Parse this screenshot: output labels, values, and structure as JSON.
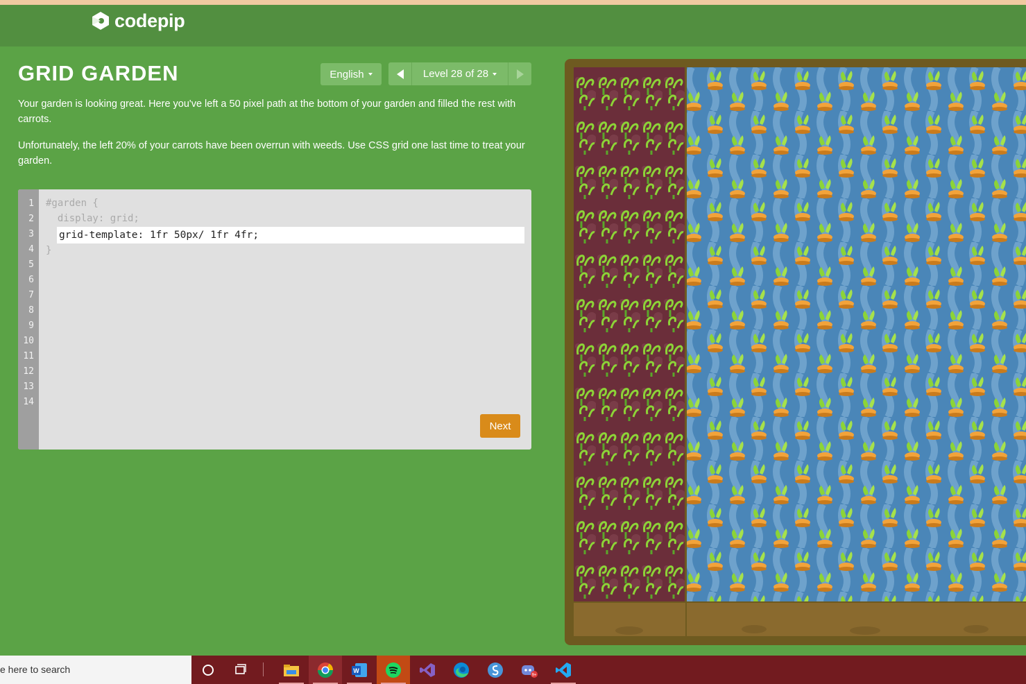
{
  "brand": {
    "name": "codepip"
  },
  "game": {
    "title": "GRID GARDEN",
    "language": "English",
    "level_label": "Level 28 of 28",
    "description": [
      "Your garden is looking great. Here you've left a 50 pixel path at the bottom of your garden and filled the rest with carrots.",
      "Unfortunately, the left 20% of your carrots have been overrun with weeds. Use CSS grid one last time to treat your garden."
    ]
  },
  "editor": {
    "line_numbers": [
      "1",
      "2",
      "3",
      "4",
      "5",
      "6",
      "7",
      "8",
      "9",
      "10",
      "11",
      "12",
      "13",
      "14"
    ],
    "code_line1": "#garden {",
    "code_line2": "  display: grid;",
    "input_value": "grid-template: 1fr 50px/ 1fr 4fr;",
    "code_line4": "}",
    "next_label": "Next"
  },
  "taskbar": {
    "search_text": "e here to search",
    "icons": [
      "cortana-icon",
      "task-view-icon",
      "file-explorer-icon",
      "chrome-icon",
      "word-icon",
      "spotify-icon",
      "visual-studio-icon",
      "edge-icon",
      "simplenote-icon",
      "discord-icon",
      "vscode-icon"
    ]
  },
  "colors": {
    "page_bg": "#5ba346",
    "header_bg": "#528f40",
    "button_bg": "#7cbb69",
    "next_button": "#d98b1a",
    "weed_bg": "#6b2e3a",
    "carrot_bg": "#4a86b8",
    "dirt": "#8a6a2e",
    "taskbar": "#721b1f"
  }
}
